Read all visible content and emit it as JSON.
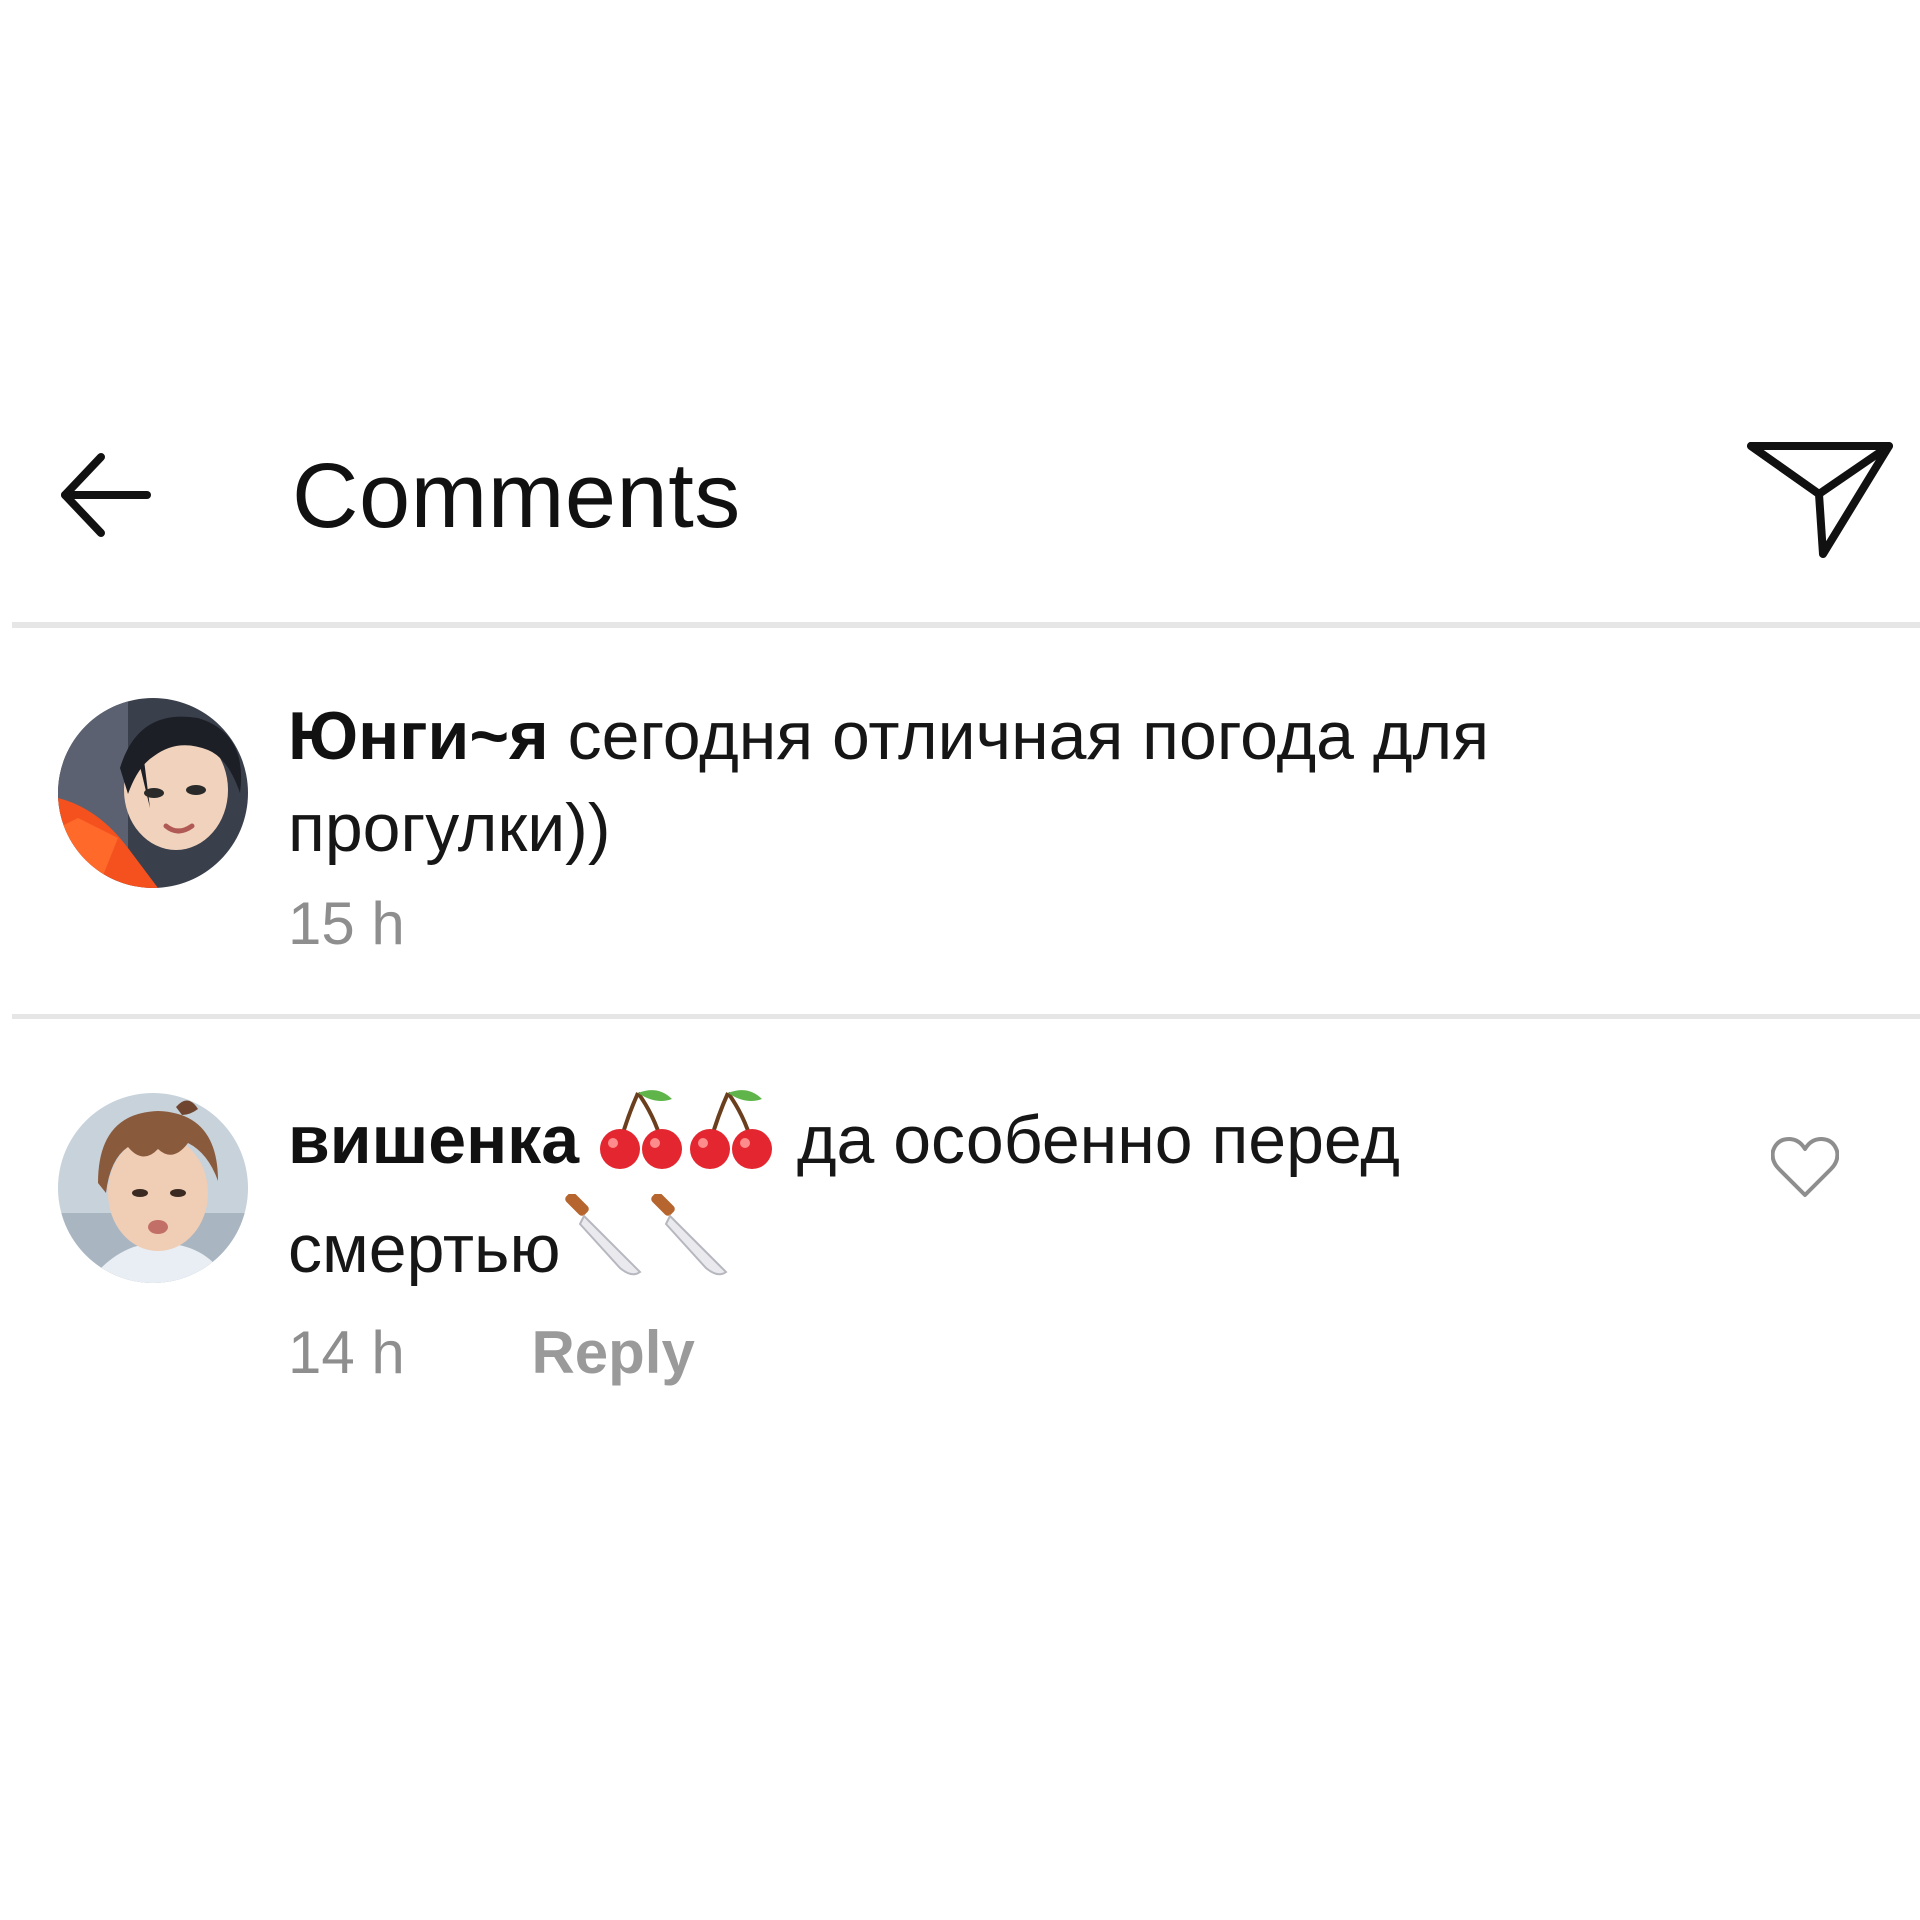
{
  "header": {
    "title": "Comments",
    "back_icon": "arrow-left-icon",
    "send_icon": "paper-plane-icon"
  },
  "comments": [
    {
      "username": "Юнги~я",
      "text": "сегодня отличная погода для прогулки))",
      "time": "15 h",
      "avatar_colors": [
        "#f4511e",
        "#2b2f3a",
        "#f1d3bd"
      ]
    },
    {
      "username": "вишенка",
      "text_part1": "да особенно перед смертью",
      "time": "14 h",
      "reply_label": "Reply",
      "emojis_after_name": [
        "cherries-icon",
        "cherries-icon"
      ],
      "emojis_after_text": [
        "knife-icon",
        "knife-icon"
      ],
      "avatar_colors": [
        "#c7d2db",
        "#8a5a3c",
        "#f0cdb5"
      ]
    }
  ],
  "colors": {
    "text": "#111111",
    "muted": "#8e8e8e",
    "divider": "#e6e6e6"
  }
}
